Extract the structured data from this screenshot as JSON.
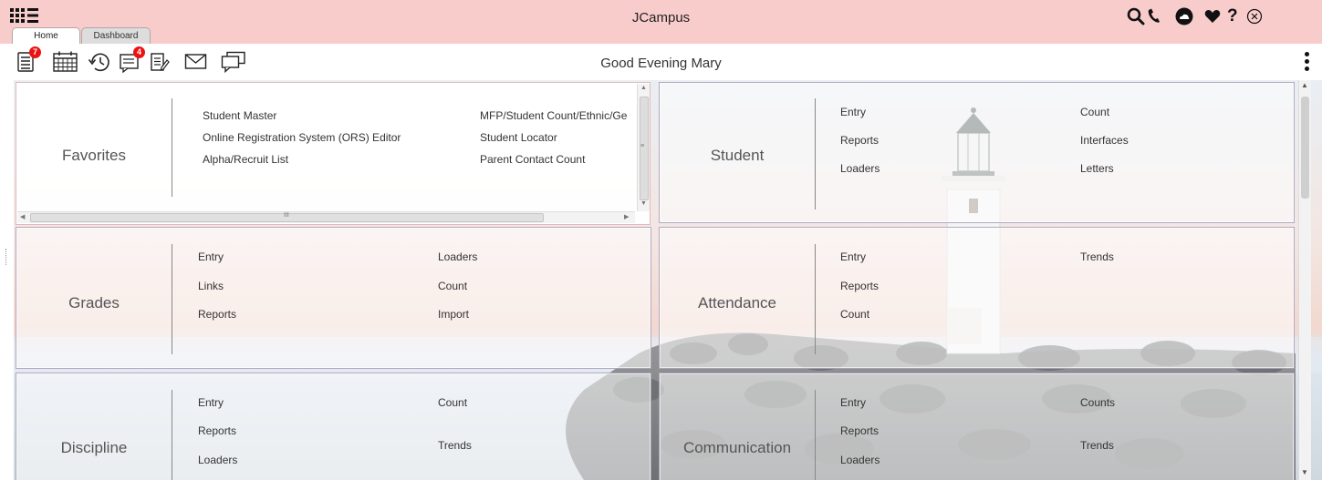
{
  "app": {
    "title": "JCampus"
  },
  "tabs": [
    {
      "label": "Home"
    },
    {
      "label": "Dashboard"
    }
  ],
  "toolbar": {
    "greeting": "Good Evening Mary",
    "icons": [
      {
        "name": "notes-icon",
        "badge": "7"
      },
      {
        "name": "calendar-icon"
      },
      {
        "name": "history-icon"
      },
      {
        "name": "tasks-icon",
        "badge": "4"
      },
      {
        "name": "document-icon"
      },
      {
        "name": "mail-icon"
      },
      {
        "name": "chat-icon"
      }
    ]
  },
  "top_icons": [
    "search-icon",
    "phone-icon",
    "cloud-icon",
    "heart-icon",
    "help-icon",
    "close-icon"
  ],
  "tiles": {
    "favorites": {
      "title": "Favorites",
      "col1": [
        "Student Master",
        "Online Registration System (ORS) Editor",
        "Alpha/Recruit List"
      ],
      "col2": [
        "MFP/Student Count/Ethnic/Ge",
        "Student Locator",
        "Parent Contact Count"
      ]
    },
    "student": {
      "title": "Student",
      "col1": [
        "Entry",
        "Reports",
        "Loaders"
      ],
      "col2": [
        "Count",
        "Interfaces",
        "Letters"
      ]
    },
    "grades": {
      "title": "Grades",
      "col1": [
        "Entry",
        "Links",
        "Reports"
      ],
      "col2": [
        "Loaders",
        "Count",
        "Import"
      ]
    },
    "attendance": {
      "title": "Attendance",
      "col1": [
        "Entry",
        "Reports",
        "Count"
      ],
      "col2": [
        "Trends"
      ]
    },
    "discipline": {
      "title": "Discipline",
      "col1": [
        "Entry",
        "Reports",
        "Loaders"
      ],
      "col2": [
        "Count",
        "Trends"
      ]
    },
    "communication": {
      "title": "Communication",
      "col1": [
        "Entry",
        "Reports",
        "Loaders"
      ],
      "col2": [
        "Counts",
        "Trends"
      ]
    }
  }
}
